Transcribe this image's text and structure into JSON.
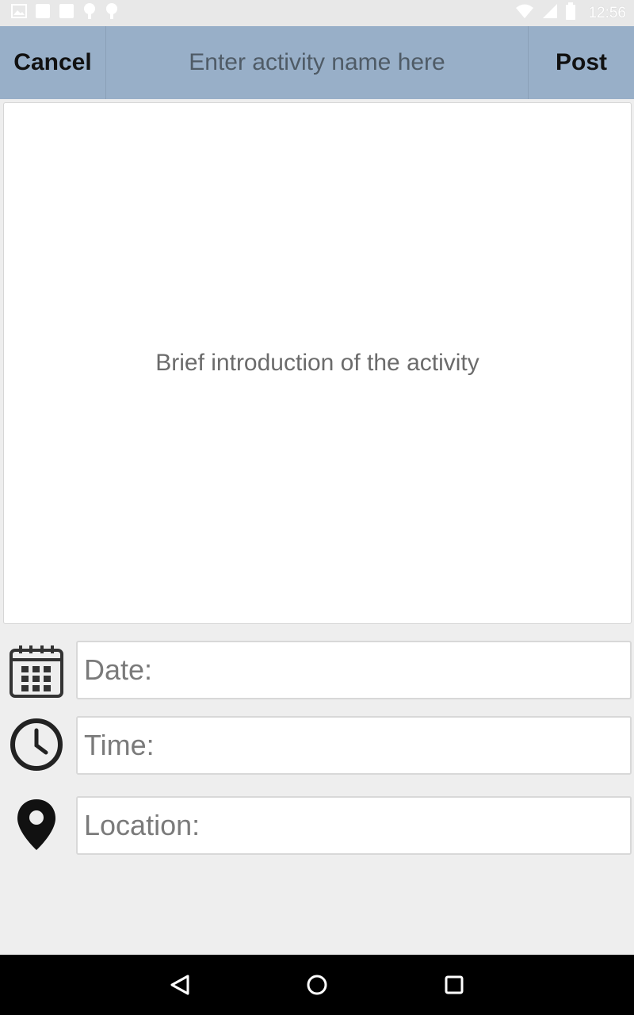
{
  "status_bar": {
    "time": "12:56",
    "left_icons": [
      "image-icon",
      "square-icon",
      "square-icon",
      "android-icon",
      "android-icon"
    ],
    "right_icons": [
      "wifi-icon",
      "signal-icon",
      "battery-icon"
    ]
  },
  "top_bar": {
    "cancel_label": "Cancel",
    "activity_name_placeholder": "Enter activity name here",
    "post_label": "Post"
  },
  "description": {
    "placeholder": "Brief introduction of the activity"
  },
  "form": {
    "date": {
      "label": "Date:",
      "icon": "calendar-icon"
    },
    "time": {
      "label": "Time:",
      "icon": "clock-icon"
    },
    "location": {
      "label": "Location:",
      "icon": "location-pin-icon"
    }
  },
  "nav_bar": {
    "buttons": [
      "back-icon",
      "home-icon",
      "recents-icon"
    ]
  },
  "colors": {
    "top_bar": "#98afc8",
    "background": "#eeeeee",
    "nav_bar": "#000000"
  }
}
